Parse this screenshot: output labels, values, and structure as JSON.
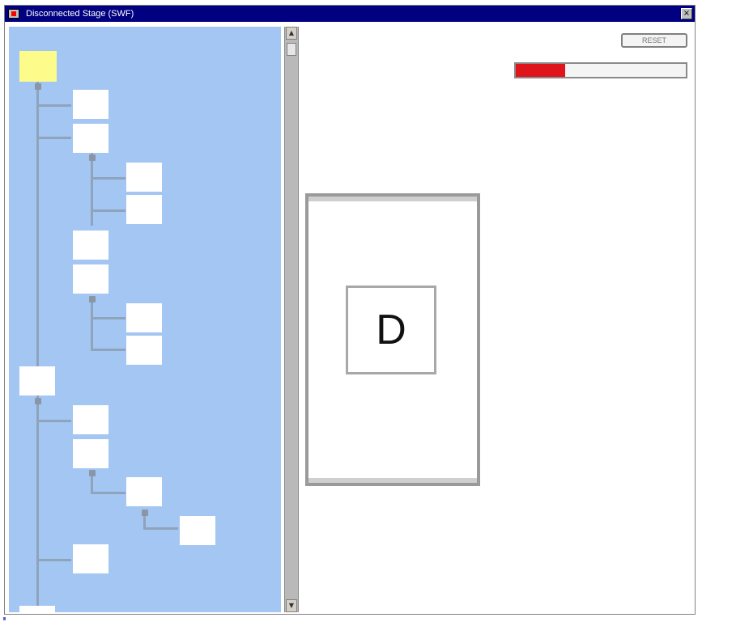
{
  "window": {
    "title": "Disconnected Stage (SWF)",
    "close_glyph": "×",
    "icon": "app-icon"
  },
  "scrollbar": {
    "up_glyph": "▲",
    "down_glyph": "▼"
  },
  "toolbar": {
    "reset_label": "RESET"
  },
  "progress": {
    "value_fraction": 0.29,
    "fill_color": "#e0141b"
  },
  "card": {
    "letter": "D"
  },
  "tree": {
    "background_color": "#a3c6f2",
    "selected_color": "#fdfb8a"
  }
}
